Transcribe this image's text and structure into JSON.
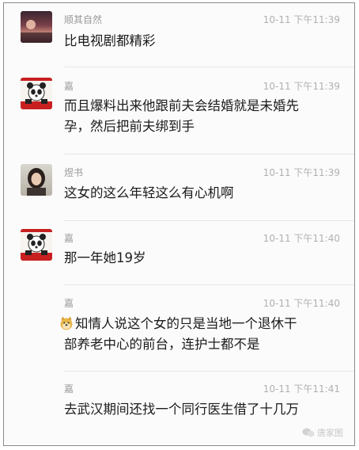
{
  "messages": [
    {
      "name": "顺其自然",
      "time": "10-11 下午11:39",
      "lines": [
        "比电视剧都精彩"
      ],
      "avatar": "sunset-avatar"
    },
    {
      "name": "嘉",
      "time": "10-11 下午11:39",
      "lines": [
        "而且爆料出来他跟前夫会结婚就是未婚先",
        "孕，然后把前夫绑到手"
      ],
      "avatar": "panda-avatar"
    },
    {
      "name": "煜书",
      "time": "10-11 下午11:39",
      "lines": [
        "这女的这么年轻这么有心机啊"
      ],
      "avatar": "woman-avatar"
    },
    {
      "name": "嘉",
      "time": "10-11 下午11:40",
      "lines": [
        "那一年她19岁"
      ],
      "avatar": "panda-avatar"
    },
    {
      "name": "嘉",
      "time": "10-11 下午11:40",
      "lines": [
        "知情人说这个女的只是当地一个退休干",
        "部养老中心的前台，连护士都不是"
      ],
      "avatar": "none"
    },
    {
      "name": "嘉",
      "time": "10-11 下午11:41",
      "lines": [
        "去武汉期间还找一个同行医生借了十几万"
      ],
      "avatar": "none"
    }
  ],
  "watermark": {
    "text": "唐家图"
  },
  "colors": {
    "background": "#fbfbfb",
    "text": "#1b1b1b",
    "meta": "#9a9a9a"
  }
}
